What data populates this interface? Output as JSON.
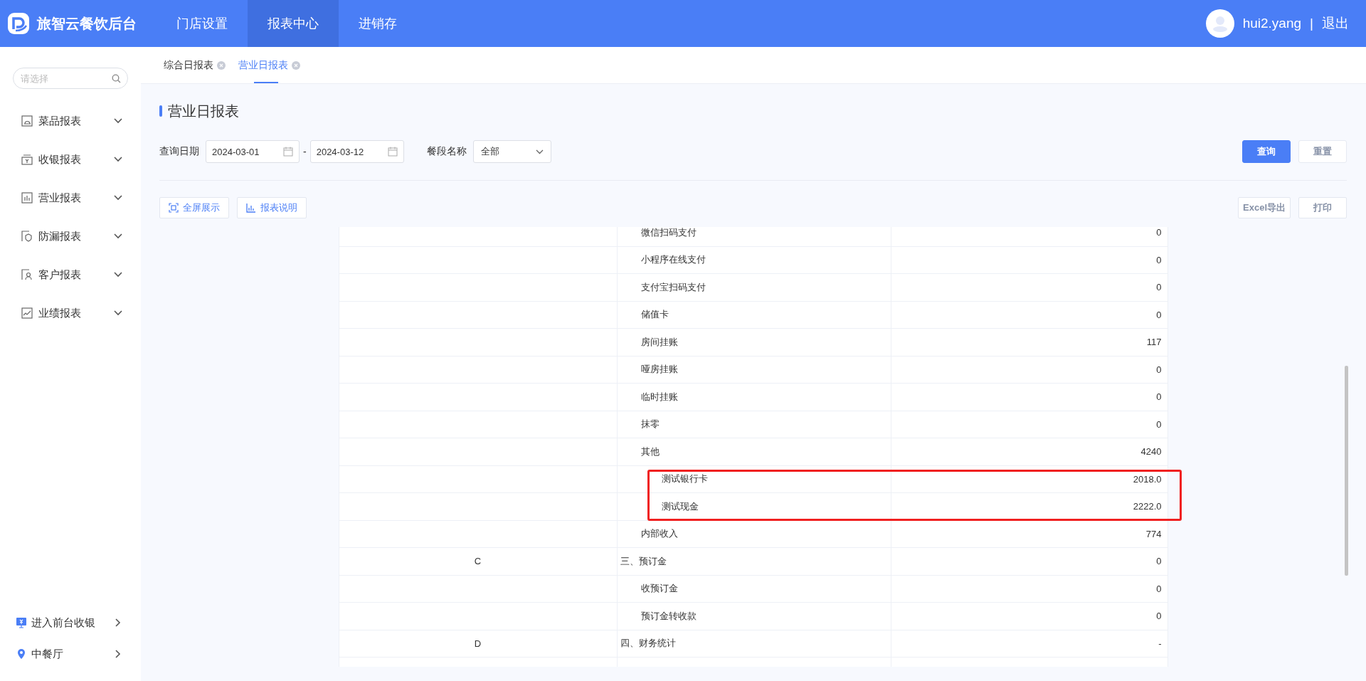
{
  "header": {
    "brand": "旅智云餐饮后台",
    "nav": [
      {
        "label": "门店设置",
        "selected": false
      },
      {
        "label": "报表中心",
        "selected": true
      },
      {
        "label": "进销存",
        "selected": false
      }
    ],
    "user": "hui2.yang",
    "separator": "|",
    "logout": "退出"
  },
  "sidebar": {
    "search": {
      "placeholder": "请选择"
    },
    "items": [
      {
        "label": "菜品报表",
        "kind": "dish"
      },
      {
        "label": "收银报表",
        "kind": "cashier"
      },
      {
        "label": "营业报表",
        "kind": "business"
      },
      {
        "label": "防漏报表",
        "kind": "shield"
      },
      {
        "label": "客户报表",
        "kind": "customer"
      },
      {
        "label": "业绩报表",
        "kind": "trend"
      }
    ],
    "bottom": [
      {
        "label": "进入前台收银",
        "kind": "register"
      },
      {
        "label": "中餐厅",
        "kind": "location"
      }
    ]
  },
  "tabs": [
    {
      "label": "综合日报表",
      "selected": false
    },
    {
      "label": "营业日报表",
      "selected": true
    }
  ],
  "page": {
    "title": "营业日报表",
    "filters": {
      "date_label": "查询日期",
      "start": "2024-03-01",
      "separator": "-",
      "end": "2024-03-12",
      "meal_label": "餐段名称",
      "meal_value": "全部"
    },
    "buttons": [
      {
        "label": "查询",
        "kind": "primary"
      },
      {
        "label": "重置",
        "kind": "default"
      }
    ],
    "tools": [
      {
        "label": "全屏展示",
        "kind": "fullscreen"
      },
      {
        "label": "报表说明",
        "kind": "chart"
      }
    ],
    "exports": [
      {
        "label": "Excel导出"
      },
      {
        "label": "打印"
      }
    ]
  },
  "table": {
    "rows": [
      {
        "children": [
          {
            "label": "微信扫码支付",
            "value": "0"
          },
          {
            "label": "小程序在线支付",
            "value": "0"
          },
          {
            "label": "支付宝扫码支付",
            "value": "0"
          },
          {
            "label": "储值卡",
            "value": "0"
          },
          {
            "label": "房间挂账",
            "value": "117"
          },
          {
            "label": "哑房挂账",
            "value": "0"
          },
          {
            "label": "临时挂账",
            "value": "0"
          },
          {
            "label": "抹零",
            "value": "0"
          },
          {
            "label": "其他",
            "value": "4240",
            "highlight_children": true,
            "children": [
              {
                "label": "测试银行卡",
                "value": "2018.0"
              },
              {
                "label": "测试现金",
                "value": "2222.0"
              }
            ]
          },
          {
            "label": "内部收入",
            "value": "774"
          }
        ]
      },
      {
        "code": "C",
        "label": "三、预订金",
        "value": "0",
        "children": [
          {
            "label": "收预订金",
            "value": "0"
          },
          {
            "label": "预订金转收款",
            "value": "0"
          }
        ]
      },
      {
        "code": "D",
        "label": "四、财务统计",
        "value": "-"
      }
    ]
  }
}
